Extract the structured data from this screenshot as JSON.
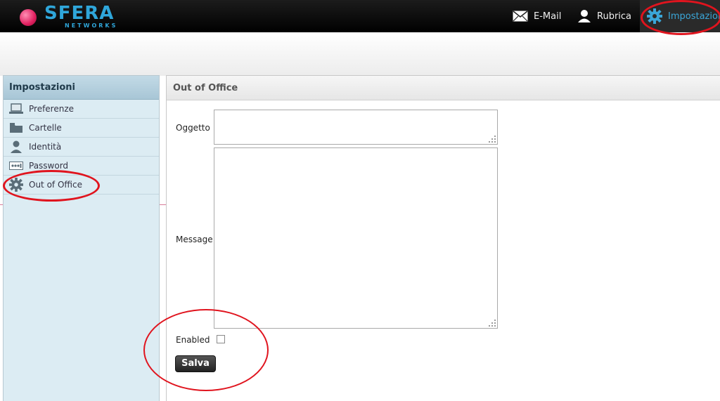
{
  "brand": {
    "name": "SFERA",
    "sub": "NETWORKS"
  },
  "nav": [
    {
      "label": "E-Mail",
      "icon": "envelope-icon"
    },
    {
      "label": "Rubrica",
      "icon": "person-icon"
    },
    {
      "label": "Impostazioni",
      "icon": "gear-icon",
      "active": true
    }
  ],
  "sidebar": {
    "title": "Impostazioni",
    "items": [
      {
        "label": "Preferenze",
        "icon": "laptop-icon"
      },
      {
        "label": "Cartelle",
        "icon": "folder-icon"
      },
      {
        "label": "Identità",
        "icon": "identity-icon"
      },
      {
        "label": "Password",
        "icon": "password-icon"
      },
      {
        "label": "Out of Office",
        "icon": "gear-icon"
      }
    ]
  },
  "panel": {
    "title": "Out of Office",
    "subject_label": "Oggetto",
    "subject_value": "",
    "message_label": "Message",
    "message_value": "",
    "enabled_label": "Enabled",
    "enabled": false,
    "save_label": "Salva"
  },
  "colors": {
    "accent": "#3aa6d8",
    "annotation": "#e0141e",
    "sidebar_bg": "#dcecf3"
  }
}
